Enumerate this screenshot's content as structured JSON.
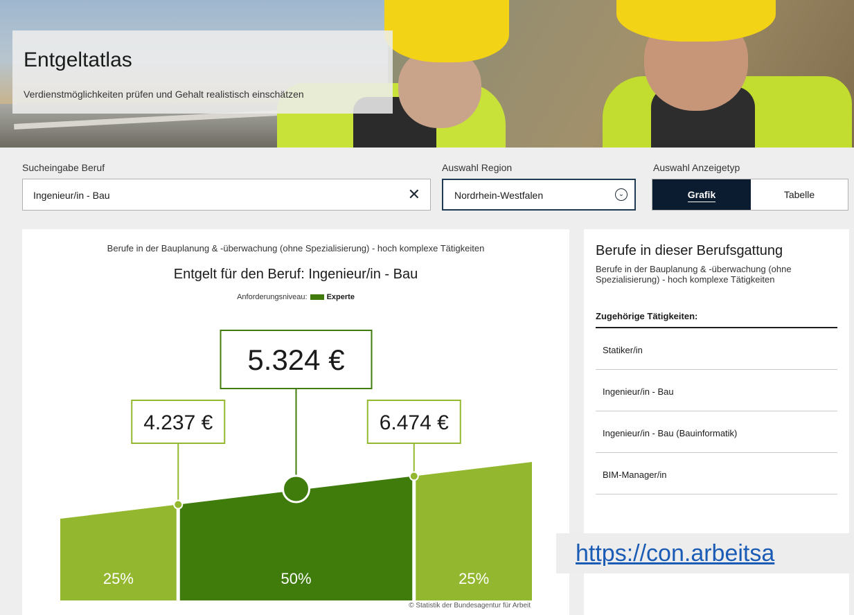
{
  "hero": {
    "title": "Entgeltatlas",
    "subtitle": "Verdienstmöglichkeiten prüfen und Gehalt realistisch einschätzen"
  },
  "filters": {
    "search_label": "Sucheingabe Beruf",
    "search_value": "Ingenieur/in - Bau",
    "region_label": "Auswahl Region",
    "region_value": "Nordrhein-Westfalen",
    "type_label": "Auswahl Anzeigetyp",
    "type_options": [
      "Grafik",
      "Tabelle"
    ],
    "type_selected": "Grafik"
  },
  "chart": {
    "subtitle": "Berufe in der Bauplanung & -überwachung (ohne Spezialisierung) - hoch komplexe Tätigkeiten",
    "title": "Entgelt für den Beruf: Ingenieur/in - Bau",
    "level_label": "Anforderungsniveau:",
    "level_value": "Experte",
    "copyright": "© Statistik der Bundesagentur für Arbeit"
  },
  "chart_data": {
    "type": "area",
    "title": "Entgelt für den Beruf: Ingenieur/in - Bau",
    "segments": [
      {
        "label": "25%",
        "share": 25
      },
      {
        "label": "50%",
        "share": 50
      },
      {
        "label": "25%",
        "share": 25
      }
    ],
    "values": [
      {
        "name": "Q1",
        "value": 4237,
        "label": "4.237 €"
      },
      {
        "name": "Median",
        "value": 5324,
        "label": "5.324 €"
      },
      {
        "name": "Q3",
        "value": 6474,
        "label": "6.474 €"
      }
    ],
    "colors": {
      "outer": "#93b82f",
      "middle": "#3f7c0c",
      "box_border": "#93b82f",
      "median_border": "#3f7c0c"
    }
  },
  "side": {
    "title": "Berufe in dieser Berufsgattung",
    "description": "Berufe in der Bauplanung & -überwachung (ohne Spezialisierung) - hoch komplexe Tätigkeiten",
    "related_heading": "Zugehörige Tätigkeiten:",
    "items": [
      "Statiker/in",
      "Ingenieur/in - Bau",
      "Ingenieur/in - Bau (Bauinformatik)",
      "BIM-Manager/in"
    ]
  },
  "overlay": {
    "url_text": "https://con.arbeitsa"
  }
}
